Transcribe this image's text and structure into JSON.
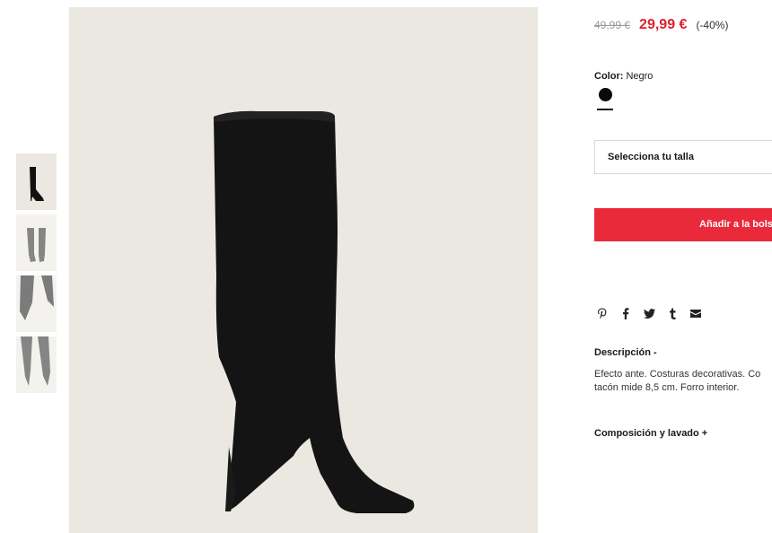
{
  "thumbnails": [
    {
      "label": "Bota vista lateral"
    },
    {
      "label": "Bota puesta vista frontal"
    },
    {
      "label": "Detalle puntera"
    },
    {
      "label": "Bota puesta vista trasera"
    }
  ],
  "product": {
    "price_old": "49,99 €",
    "price_new": "29,99 €",
    "discount": "(-40%)",
    "color_label": "Color:",
    "color_value": "Negro",
    "swatch_color": "#0a0a0a",
    "size_placeholder": "Selecciona tu talla",
    "add_button": "Añadir a la bolsa",
    "accent_color": "#ea2a3b"
  },
  "share": {
    "icons": [
      "pinterest-icon",
      "facebook-icon",
      "twitter-icon",
      "tumblr-icon",
      "email-icon"
    ]
  },
  "description": {
    "title": "Descripción -",
    "text_line1": "Efecto ante. Costuras decorativas. Co",
    "text_line2": "tacón mide 8,5 cm. Forro interior."
  },
  "composition": {
    "title": "Composición y lavado +"
  }
}
